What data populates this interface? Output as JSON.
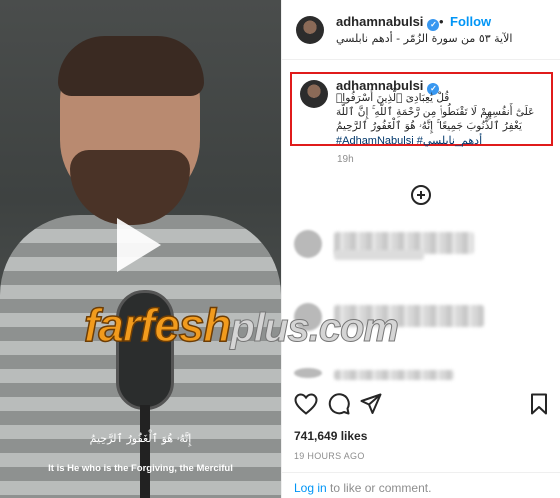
{
  "post_header": {
    "username": "adhamnabulsi",
    "separator": "•",
    "follow_label": "Follow",
    "subtitle": "الآية ٥٣ من سورة الزُمّر - أدهم نابلسي"
  },
  "caption": {
    "username": "adhamnabulsi",
    "line1": "قُلْ يَٰعِبَادِىَ ٱلَّذِينَ أَسْرَفُوا۟",
    "line2": "عَلَىٰٓ أَنفُسِهِمْ لَا تَقْنَطُوا۟ مِن رَّحْمَةِ ٱللَّهِ ۚ إِنَّ ٱللَّهَ",
    "line3": "يَغْفِرُ ٱلذُّنُوبَ جَمِيعًا ۚ إِنَّهُۥ هُوَ ٱلْغَفُورُ ٱلرَّحِيمُ",
    "hashtags": "#AdhamNabulsi #أدهم_نابلسي",
    "time": "19h"
  },
  "video": {
    "caption_arabic": "إِنَّهُۥ هُوَ ٱلْغَفُورُ ٱلرَّحِيمُ",
    "caption_english": "It is He who is the Forgiving, the Merciful"
  },
  "watermark": {
    "part1": "farfesh",
    "part2": "plus.com"
  },
  "engagement": {
    "likes": "741,649 likes",
    "posted_ago": "19 HOURS AGO"
  },
  "footer": {
    "login_label": "Log in",
    "rest": " to like or comment."
  },
  "icons": [
    "play-icon",
    "verified-icon",
    "load-more-icon",
    "heart-icon",
    "comment-icon",
    "share-icon",
    "save-icon"
  ],
  "colors": {
    "follow": "#0095f6",
    "verified": "#3897f0",
    "highlight_border": "#e01b1b",
    "hashtag": "#00376b",
    "watermark_orange": "#f29b1d"
  }
}
